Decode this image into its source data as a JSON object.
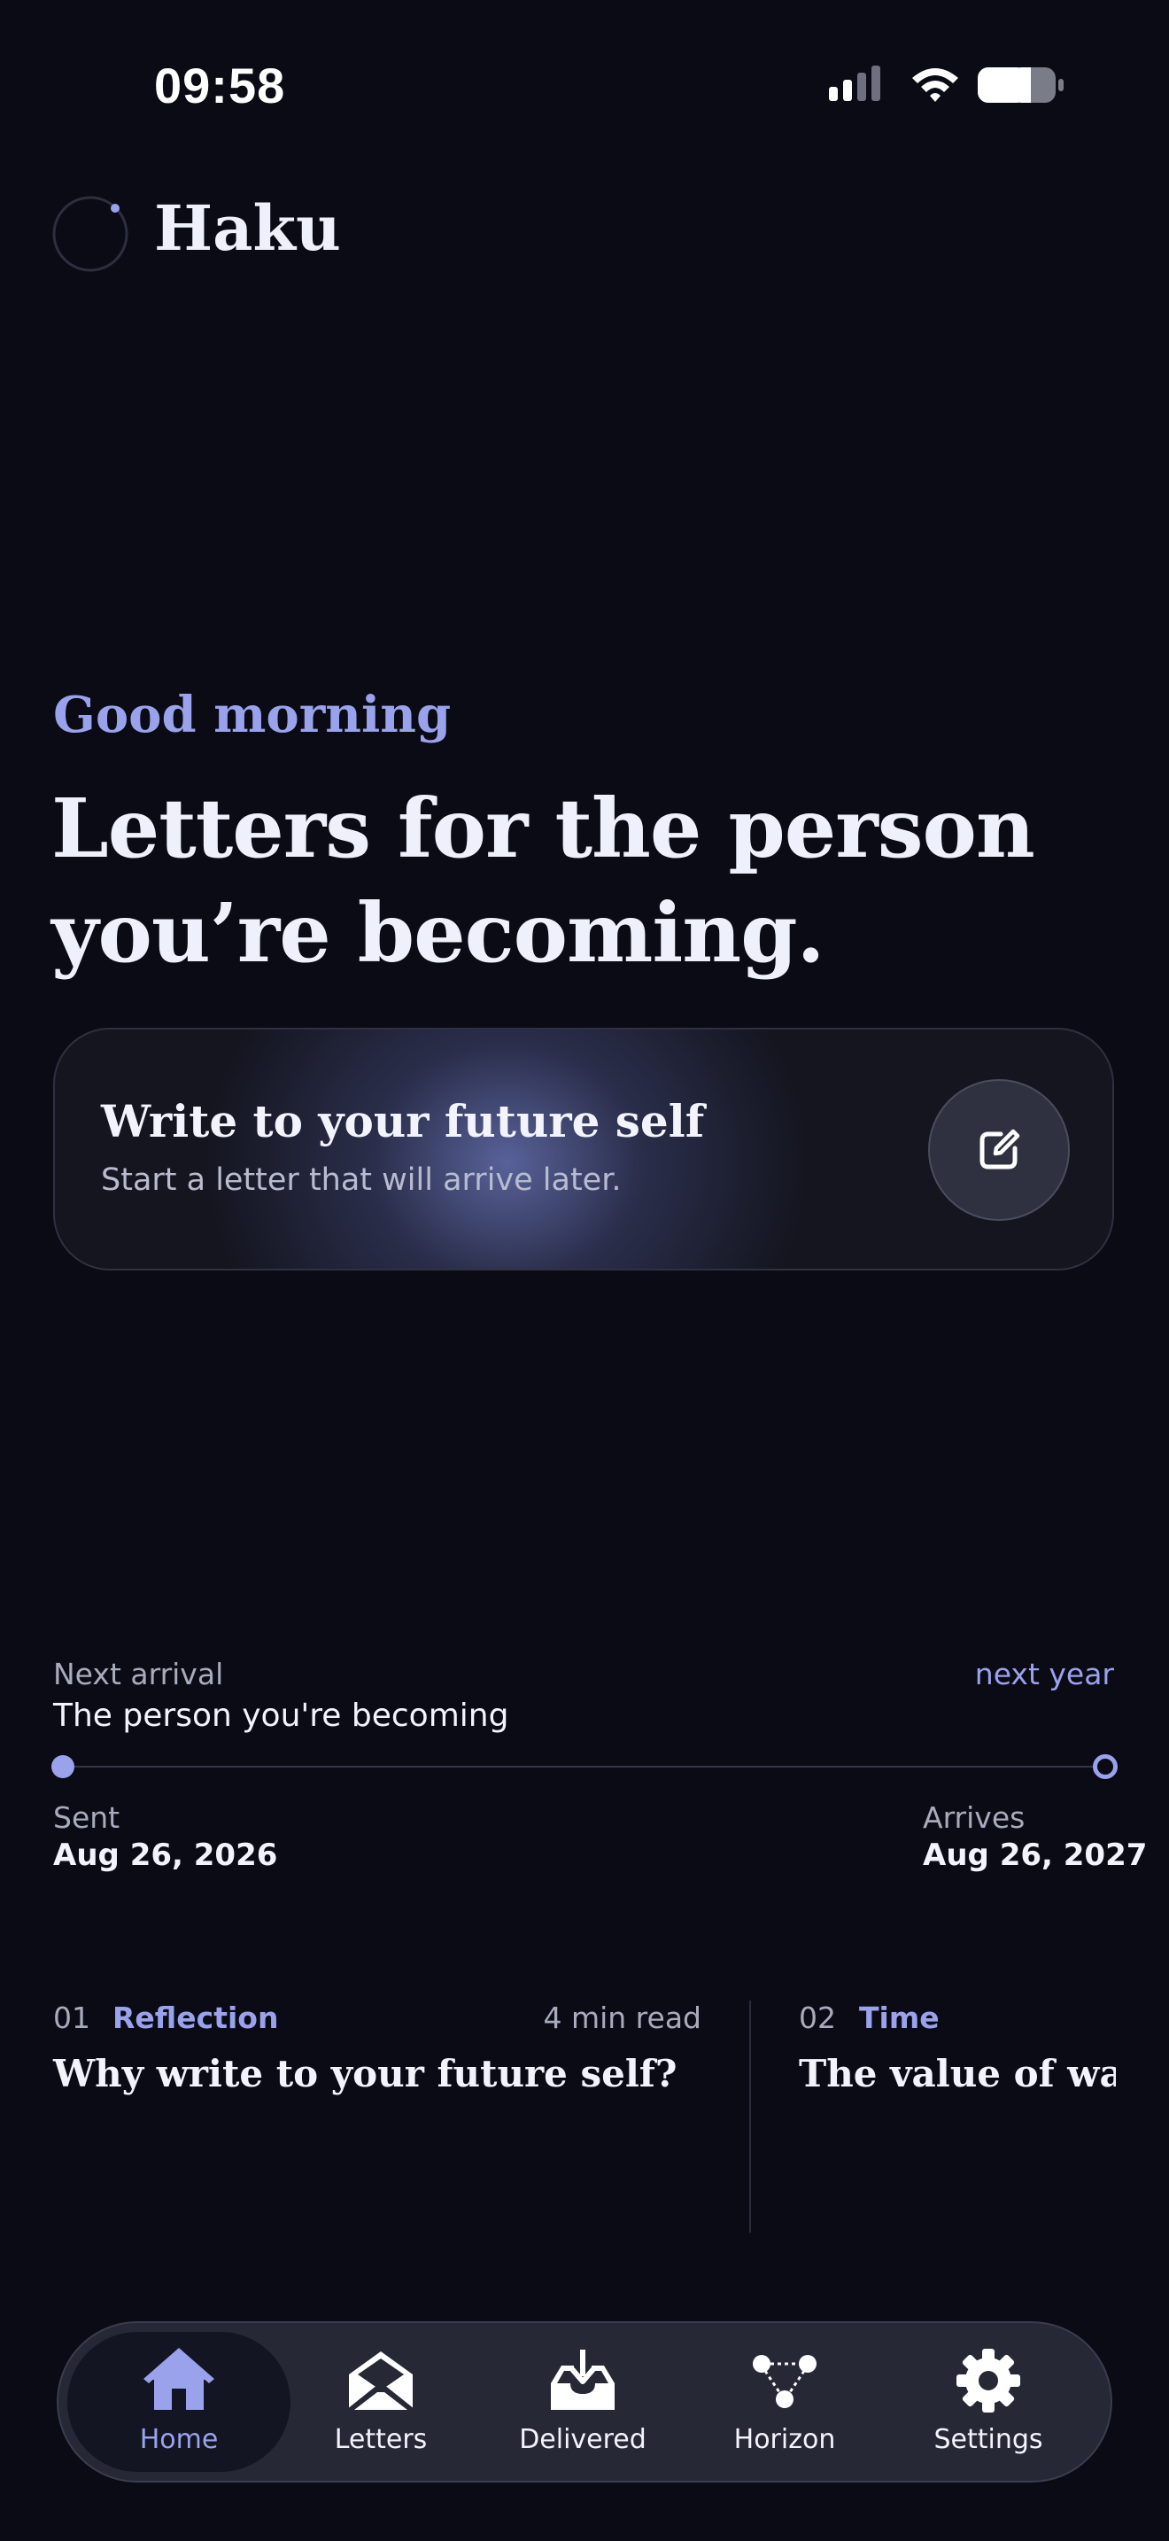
{
  "status_bar": {
    "time": "09:58"
  },
  "brand": {
    "name": "Haku"
  },
  "hero": {
    "greeting": "Good morning",
    "headline_line1": "Letters for the person",
    "headline_line2": "you’re becoming."
  },
  "compose": {
    "title": "Write to your future self",
    "subtitle": "Start a letter that will arrive later.",
    "icon": "compose-icon"
  },
  "next_arrival": {
    "label": "Next arrival",
    "when": "next year",
    "title": "The person you're becoming",
    "sent_label": "Sent",
    "sent_date": "Aug 26, 2026",
    "arrives_label": "Arrives",
    "arrives_date": "Aug 26, 2027"
  },
  "articles": [
    {
      "number": "01",
      "category": "Reflection",
      "read_time": "4 min read",
      "title": "Why write to your future self?"
    },
    {
      "number": "02",
      "category": "Time",
      "title": "The value of waiting"
    }
  ],
  "tabs": [
    {
      "label": "Home",
      "icon": "home-icon",
      "active": true
    },
    {
      "label": "Letters",
      "icon": "envelope-open-icon",
      "active": false
    },
    {
      "label": "Delivered",
      "icon": "inbox-download-icon",
      "active": false
    },
    {
      "label": "Horizon",
      "icon": "constellation-icon",
      "active": false
    },
    {
      "label": "Settings",
      "icon": "gear-icon",
      "active": false
    }
  ],
  "colors": {
    "background": "#0a0b14",
    "accent": "#9aa2ec",
    "text": "#eef0fb",
    "muted": "#a8abbd"
  }
}
